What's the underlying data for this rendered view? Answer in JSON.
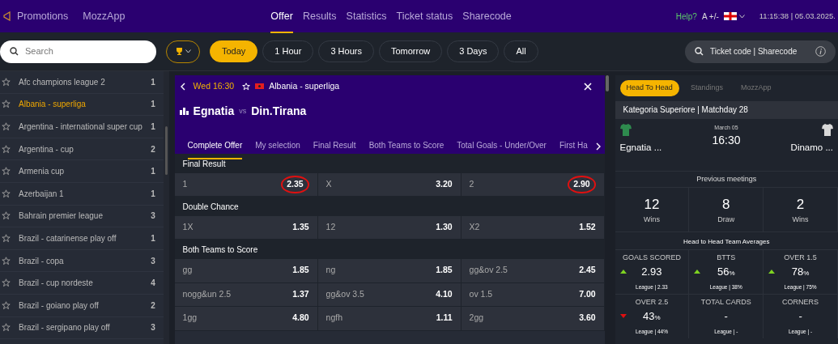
{
  "topnav": {
    "left": [
      "Promotions",
      "MozzApp"
    ],
    "tabs": [
      {
        "label": "Offer",
        "selected": true
      },
      {
        "label": "Results",
        "selected": false
      },
      {
        "label": "Statistics",
        "selected": false
      },
      {
        "label": "Ticket status",
        "selected": false
      },
      {
        "label": "Sharecode",
        "selected": false
      }
    ],
    "help": "Help?",
    "font_size": "A +/-",
    "datetime": "11:15:38 | 05.03.2025."
  },
  "filters": {
    "search": {
      "placeholder": "Search"
    },
    "periods": [
      {
        "label": "Today",
        "selected": true
      },
      {
        "label": "1 Hour",
        "selected": false
      },
      {
        "label": "3 Hours",
        "selected": false
      },
      {
        "label": "Tomorrow",
        "selected": false
      },
      {
        "label": "3 Days",
        "selected": false
      },
      {
        "label": "All",
        "selected": false
      }
    ],
    "ticket_search": {
      "placeholder": "Ticket code | Sharecode"
    }
  },
  "leagues": [
    {
      "name": "Afc champions league 2",
      "count": "1",
      "selected": false
    },
    {
      "name": "Albania - superliga",
      "count": "1",
      "selected": true
    },
    {
      "name": "Argentina - international super cup",
      "count": "1",
      "selected": false
    },
    {
      "name": "Argentina - cup",
      "count": "2",
      "selected": false
    },
    {
      "name": "Armenia cup",
      "count": "1",
      "selected": false
    },
    {
      "name": "Azerbaijan 1",
      "count": "1",
      "selected": false
    },
    {
      "name": "Bahrain premier league",
      "count": "3",
      "selected": false
    },
    {
      "name": "Brazil - catarinense play off",
      "count": "1",
      "selected": false
    },
    {
      "name": "Brazil - copa",
      "count": "3",
      "selected": false
    },
    {
      "name": "Brazil - cup nordeste",
      "count": "4",
      "selected": false
    },
    {
      "name": "Brazil - goiano play off",
      "count": "2",
      "selected": false
    },
    {
      "name": "Brazil - sergipano play off",
      "count": "3",
      "selected": false
    }
  ],
  "match": {
    "time": "Wed 16:30",
    "league": "Albania - superliga",
    "home": "Egnatia",
    "vs": "vs",
    "away": "Din.Tirana",
    "tabs": [
      {
        "label": "Complete Offer",
        "selected": true
      },
      {
        "label": "My selection",
        "selected": false
      },
      {
        "label": "Final Result",
        "selected": false
      },
      {
        "label": "Both Teams to Score",
        "selected": false
      },
      {
        "label": "Total Goals - Under/Over",
        "selected": false
      },
      {
        "label": "First Ha",
        "selected": false
      }
    ],
    "markets": [
      {
        "title": "Final Result",
        "odds": [
          {
            "label": "1",
            "value": "2.35",
            "circled": true
          },
          {
            "label": "X",
            "value": "3.20",
            "circled": false
          },
          {
            "label": "2",
            "value": "2.90",
            "circled": true
          }
        ]
      },
      {
        "title": "Double Chance",
        "odds": [
          {
            "label": "1X",
            "value": "1.35",
            "circled": false
          },
          {
            "label": "12",
            "value": "1.30",
            "circled": false
          },
          {
            "label": "X2",
            "value": "1.52",
            "circled": false
          }
        ]
      },
      {
        "title": "Both Teams to Score",
        "odds": [
          {
            "label": "gg",
            "value": "1.85",
            "circled": false
          },
          {
            "label": "ng",
            "value": "1.85",
            "circled": false
          },
          {
            "label": "gg&ov 2.5",
            "value": "2.45",
            "circled": false
          },
          {
            "label": "nogg&un 2.5",
            "value": "1.37",
            "circled": false
          },
          {
            "label": "gg&ov 3.5",
            "value": "4.10",
            "circled": false
          },
          {
            "label": "ov 1.5",
            "value": "7.00",
            "circled": false
          },
          {
            "label": "1gg",
            "value": "4.80",
            "circled": false
          },
          {
            "label": "ngfh",
            "value": "1.11",
            "circled": false
          },
          {
            "label": "2gg",
            "value": "3.60",
            "circled": false
          }
        ]
      }
    ]
  },
  "stats": {
    "tabs": [
      {
        "label": "Head To Head",
        "selected": true
      },
      {
        "label": "Standings",
        "selected": false
      },
      {
        "label": "MozzApp",
        "selected": false
      }
    ],
    "competition": "Kategoria Superiore | Matchday 28",
    "date": "March 05",
    "time": "16:30",
    "home": {
      "name": "Egnatia ...",
      "color": "#2e8b4e"
    },
    "away": {
      "name": "Dinamo ...",
      "color": "#d8d8d8"
    },
    "previous_title": "Previous meetings",
    "previous": [
      {
        "value": "12",
        "label": "Wins"
      },
      {
        "value": "8",
        "label": "Draw"
      },
      {
        "value": "2",
        "label": "Wins"
      }
    ],
    "averages_title": "Head to Head Team Averages",
    "averages": [
      {
        "title": "GOALS SCORED",
        "value": "2.93",
        "up": true,
        "down": false,
        "league": "League | 2.33"
      },
      {
        "title": "BTTS",
        "value": "56",
        "unit": "%",
        "up": true,
        "down": false,
        "league": "League | 38%"
      },
      {
        "title": "OVER 1.5",
        "value": "78",
        "unit": "%",
        "up": true,
        "down": false,
        "league": "League | 75%"
      },
      {
        "title": "OVER 2.5",
        "value": "43",
        "unit": "%",
        "up": false,
        "down": true,
        "league": "League | 44%"
      },
      {
        "title": "TOTAL CARDS",
        "value": "-",
        "up": false,
        "down": false,
        "league": "League | -"
      },
      {
        "title": "CORNERS",
        "value": "-",
        "up": false,
        "down": false,
        "league": "League | -"
      }
    ]
  }
}
